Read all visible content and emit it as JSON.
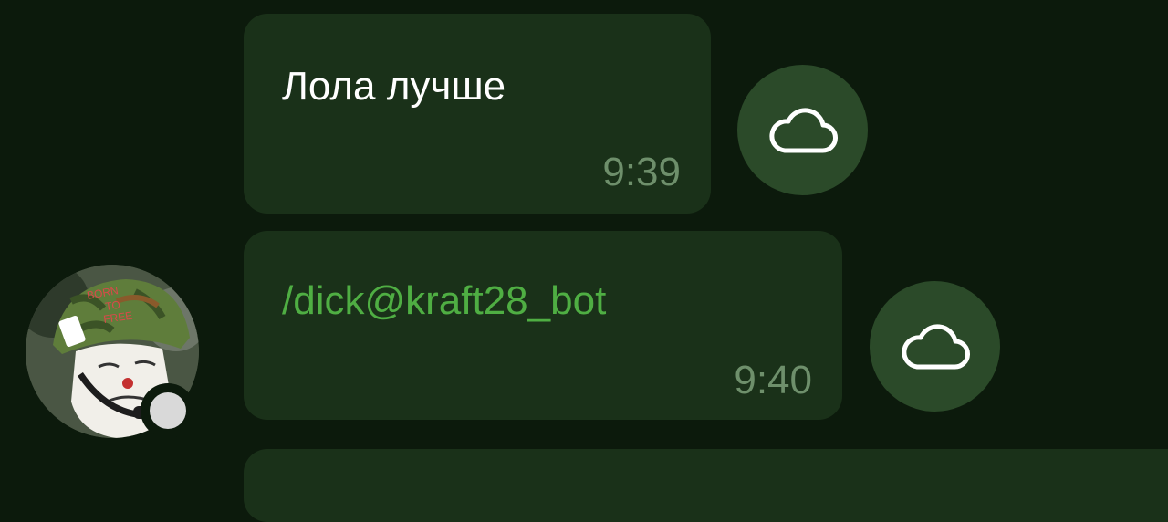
{
  "messages": [
    {
      "text": "Лола лучше",
      "time": "9:39",
      "icon": "cloud-icon"
    },
    {
      "text": "/dick@kraft28_bot",
      "time": "9:40",
      "icon": "cloud-icon"
    }
  ],
  "avatar": {
    "helmet_text": "BORN TO FREE",
    "status_icon": "offline-status-dot"
  },
  "colors": {
    "background": "#0c1a0c",
    "bubble": "#1a3119",
    "link": "#4fae43",
    "time": "#6e8f6b",
    "cloud_button": "#2b4a29"
  }
}
